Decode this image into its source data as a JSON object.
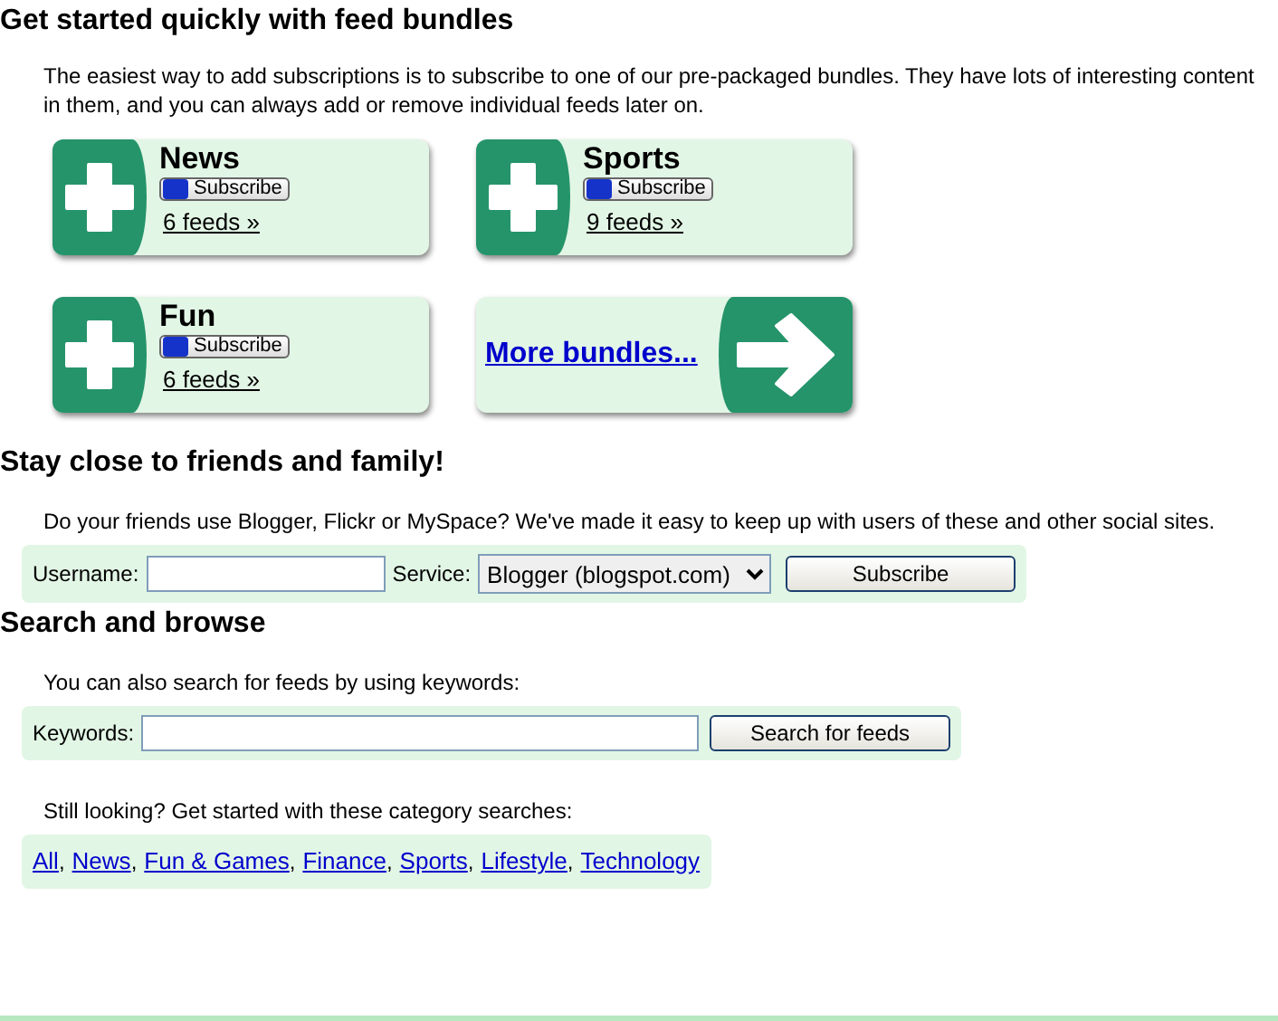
{
  "sections": [
    {
      "title": "Get started quickly with feed bundles",
      "intro": "The easiest way to add subscriptions is to subscribe to one of our pre-packaged bundles. They have lots of interesting content in them, and you can always add or remove individual feeds later on.",
      "bundles": [
        {
          "kind": "bundle",
          "name": "News",
          "button": "Subscribe",
          "feeds": "6 feeds »"
        },
        {
          "kind": "bundle",
          "name": "Sports",
          "button": "Subscribe",
          "feeds": "9 feeds »"
        },
        {
          "kind": "bundle",
          "name": "Fun",
          "button": "Subscribe",
          "feeds": "6 feeds »"
        },
        {
          "kind": "more",
          "link": "More bundles..."
        }
      ]
    },
    {
      "title": "Stay close to friends and family!",
      "intro": "Do your friends use Blogger, Flickr or MySpace? We've made it easy to keep up with users of these and other social sites.",
      "form": {
        "username_label": "Username:",
        "service_label": "Service:",
        "service_value": "Blogger (blogspot.com)",
        "button": "Subscribe"
      }
    },
    {
      "title": "Search and browse",
      "intro": "You can also search for feeds by using keywords:",
      "search": {
        "label": "Keywords:",
        "button": "Search for feeds"
      },
      "categories_intro": "Still looking? Get started with these category searches:",
      "separator": ",",
      "categories": [
        "All",
        "News",
        "Fun & Games",
        "Finance",
        "Sports",
        "Lifestyle",
        "Technology"
      ]
    }
  ]
}
